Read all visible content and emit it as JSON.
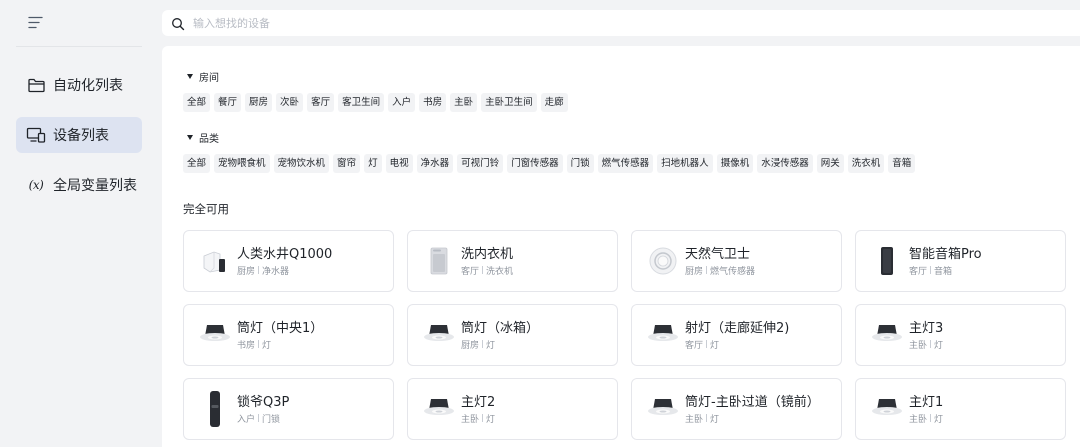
{
  "sidebar": {
    "items": [
      {
        "label": "自动化列表",
        "icon": "folder-icon",
        "active": false
      },
      {
        "label": "设备列表",
        "icon": "device-icon",
        "active": true
      },
      {
        "label": "全局变量列表",
        "icon": "variable-icon",
        "icon_text": "(x)",
        "active": false
      }
    ]
  },
  "search": {
    "placeholder": "输入想找的设备",
    "value": ""
  },
  "filters": {
    "rooms": {
      "title": "房间",
      "options": [
        "全部",
        "餐厅",
        "厨房",
        "次卧",
        "客厅",
        "客卫生间",
        "入户",
        "书房",
        "主卧",
        "主卧卫生间",
        "走廊"
      ],
      "selected": "全部"
    },
    "categories": {
      "title": "品类",
      "options": [
        "全部",
        "宠物喂食机",
        "宠物饮水机",
        "窗帘",
        "灯",
        "电视",
        "净水器",
        "可视门铃",
        "门窗传感器",
        "门锁",
        "燃气传感器",
        "扫地机器人",
        "摄像机",
        "水浸传感器",
        "网关",
        "洗衣机",
        "音箱"
      ],
      "selected": "全部"
    }
  },
  "available": {
    "title": "完全可用",
    "devices": [
      {
        "name": "人类水井Q1000",
        "room": "厨房",
        "type": "净水器",
        "icon": "water-purifier-icon"
      },
      {
        "name": "洗内衣机",
        "room": "客厅",
        "type": "洗衣机",
        "icon": "washing-machine-icon"
      },
      {
        "name": "天然气卫士",
        "room": "厨房",
        "type": "燃气传感器",
        "icon": "gas-sensor-icon"
      },
      {
        "name": "智能音箱Pro",
        "room": "客厅",
        "type": "音箱",
        "icon": "speaker-icon"
      },
      {
        "name": "筒灯（中央1）",
        "room": "书房",
        "type": "灯",
        "icon": "downlight-icon"
      },
      {
        "name": "筒灯（冰箱）",
        "room": "厨房",
        "type": "灯",
        "icon": "downlight-icon"
      },
      {
        "name": "射灯（走廊延伸2)",
        "room": "客厅",
        "type": "灯",
        "icon": "downlight-icon"
      },
      {
        "name": "主灯3",
        "room": "主卧",
        "type": "灯",
        "icon": "downlight-icon"
      },
      {
        "name": "锁爷Q3P",
        "room": "入户",
        "type": "门锁",
        "icon": "door-lock-icon"
      },
      {
        "name": "主灯2",
        "room": "主卧",
        "type": "灯",
        "icon": "downlight-icon"
      },
      {
        "name": "筒灯-主卧过道（镜前）",
        "room": "主卧",
        "type": "灯",
        "icon": "downlight-icon"
      },
      {
        "name": "主灯1",
        "room": "主卧",
        "type": "灯",
        "icon": "downlight-icon"
      }
    ]
  },
  "colors": {
    "active_nav": "#dde3f1",
    "background": "#f2f3f5",
    "chip": "#f2f3f5",
    "text": "#1f2329",
    "subtext": "#8f959e"
  }
}
